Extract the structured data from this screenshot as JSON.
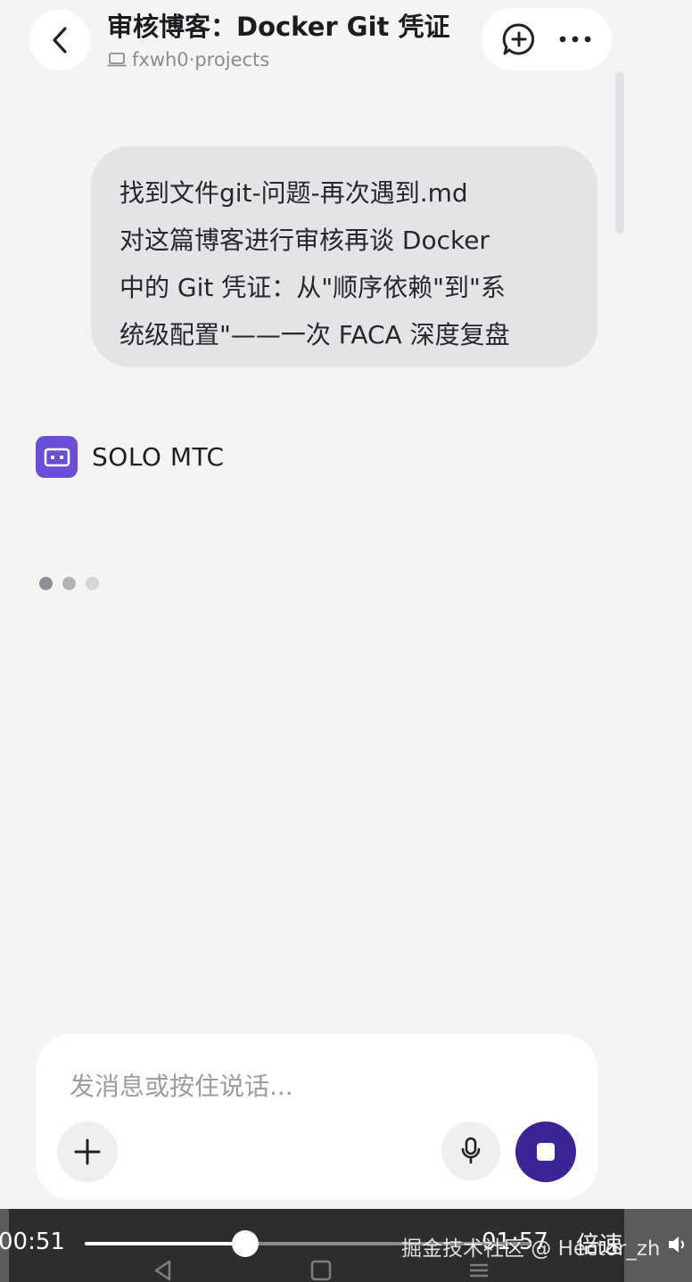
{
  "header": {
    "title": "审核博客：Docker Git 凭证",
    "workspace": "fxwh0·projects",
    "icons": [
      "chevron-left-icon",
      "laptop-icon",
      "chat-plus-icon",
      "more-icon"
    ]
  },
  "conversation": {
    "user_message_lines": [
      "找到文件git-问题-再次遇到.md",
      "对这篇博客进行审核再谈 Docker",
      "中的 Git 凭证：从\"顺序依赖\"到\"系",
      "统级配置\"——一次 FACA 深度复盘"
    ],
    "bot_name": "SOLO MTC",
    "bot_status": "typing"
  },
  "composer": {
    "placeholder": "发消息或按住说话...",
    "value": ""
  },
  "video_player": {
    "current_time": "00:51",
    "total_time": "01:57",
    "progress": 0.36,
    "speed_label": "倍速",
    "watermark": "掘金技术社区 @ Hector_zh"
  },
  "colors": {
    "background": "#f4f4f5",
    "bubble": "#e4e4e7",
    "accent": "#6a4fd6",
    "stop_button": "#3b2596",
    "muted_text": "#8b8b93"
  }
}
